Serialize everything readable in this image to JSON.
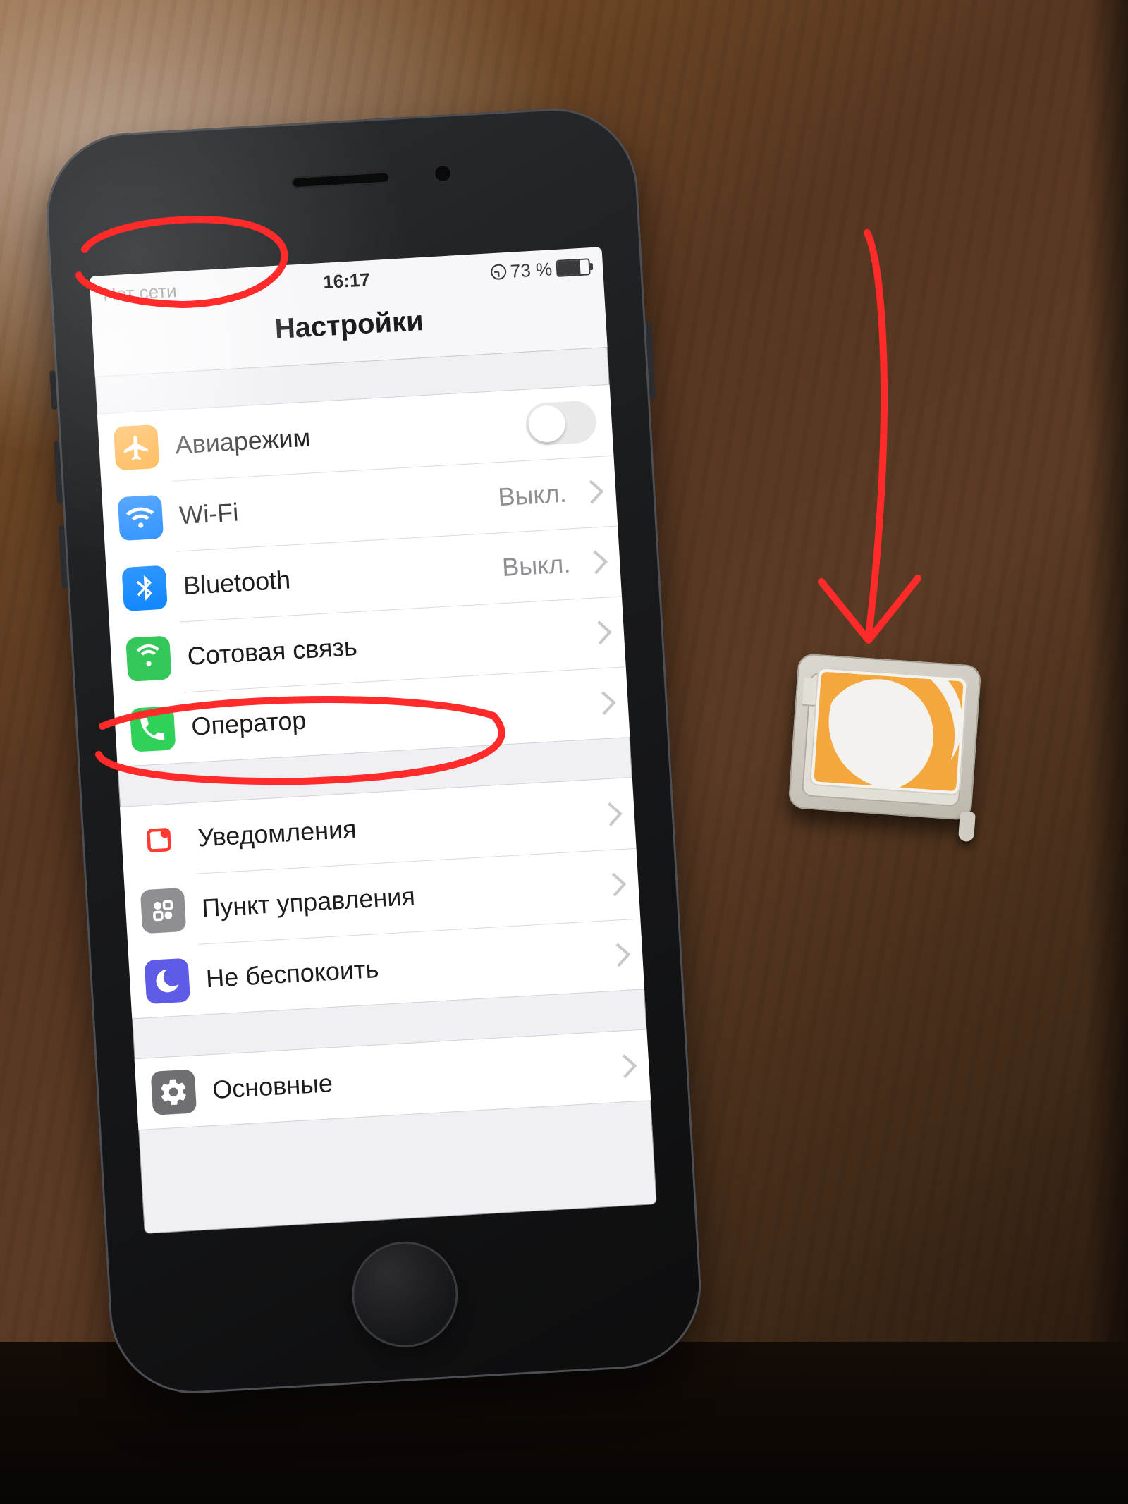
{
  "statusbar": {
    "carrier": "Нет сети",
    "time": "16:17",
    "battery_text": "73 %"
  },
  "title": "Настройки",
  "groups": [
    {
      "rows": [
        {
          "icon": "airplane-icon",
          "color": "ic-orange",
          "label": "Авиарежим",
          "value": "",
          "toggle": true
        },
        {
          "icon": "wifi-icon",
          "color": "ic-blue",
          "label": "Wi-Fi",
          "value": "Выкл."
        },
        {
          "icon": "bluetooth-icon",
          "color": "ic-blue2",
          "label": "Bluetooth",
          "value": "Выкл."
        },
        {
          "icon": "cellular-icon",
          "color": "ic-green",
          "label": "Сотовая связь",
          "value": ""
        },
        {
          "icon": "carrier-icon",
          "color": "ic-green2",
          "label": "Оператор",
          "value": ""
        }
      ]
    },
    {
      "rows": [
        {
          "icon": "notifications-icon",
          "color": "ic-red",
          "label": "Уведомления",
          "value": ""
        },
        {
          "icon": "control-center-icon",
          "color": "ic-gray",
          "label": "Пункт управления",
          "value": ""
        },
        {
          "icon": "dnd-icon",
          "color": "ic-indigo",
          "label": "Не беспокоить",
          "value": ""
        }
      ]
    },
    {
      "rows": [
        {
          "icon": "general-icon",
          "color": "ic-darkgray",
          "label": "Основные",
          "value": ""
        }
      ]
    }
  ]
}
